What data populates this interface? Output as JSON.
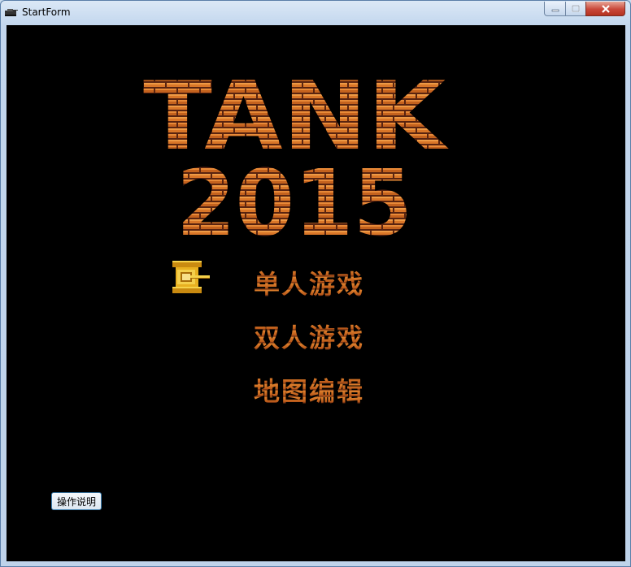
{
  "window": {
    "title": "StartForm",
    "app_icon": "tank-icon",
    "controls": {
      "minimize_icon": "minimize-icon",
      "maximize_icon": "maximize-icon",
      "close_icon": "close-icon"
    }
  },
  "game": {
    "title_line1": "TANK",
    "title_line2": "2015",
    "menu": [
      {
        "label": "单人游戏"
      },
      {
        "label": "双人游戏"
      },
      {
        "label": "地图编辑"
      }
    ],
    "selector_icon": "tank-icon",
    "help_button": "操作说明"
  },
  "colors": {
    "background": "#000000",
    "brick_light": "#e2832d",
    "brick_dark": "#b45418",
    "mortar": "#5a2410"
  }
}
